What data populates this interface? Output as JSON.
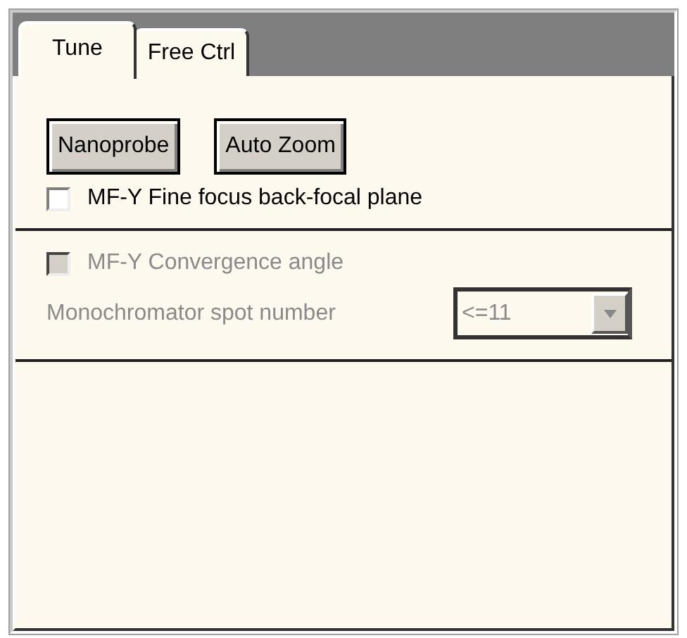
{
  "tabs": [
    {
      "label": "Tune",
      "selected": true
    },
    {
      "label": "Free Ctrl",
      "selected": false
    }
  ],
  "buttons": [
    "Nanoprobe",
    "Auto Zoom"
  ],
  "fine_focus": {
    "label": "MF-Y Fine focus back-focal plane",
    "checked": false,
    "disabled": false
  },
  "convergence": {
    "label": "MF-Y Convergence angle",
    "checked": false,
    "disabled": true
  },
  "spot": {
    "label": "Monochromator spot number",
    "value": "<=11",
    "disabled": true
  }
}
